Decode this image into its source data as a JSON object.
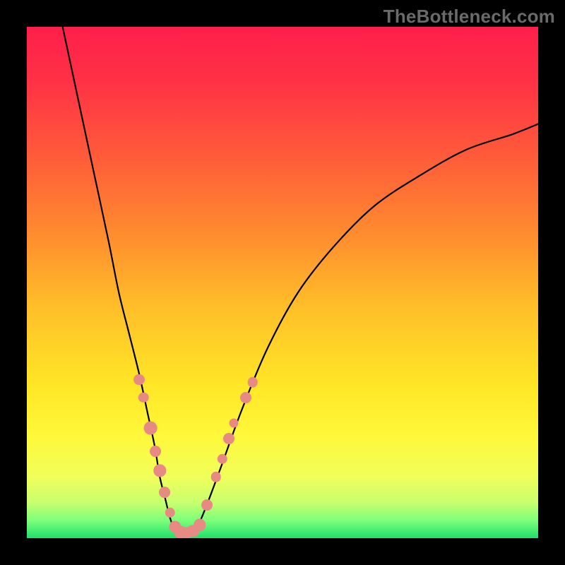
{
  "watermark": "TheBottleneck.com",
  "colors": {
    "bg": "#000000",
    "curve": "#000000",
    "point": "#e88a84",
    "gradient_stops": [
      {
        "offset": 0.0,
        "color": "#ff1f4a"
      },
      {
        "offset": 0.1,
        "color": "#ff3046"
      },
      {
        "offset": 0.25,
        "color": "#ff5a3a"
      },
      {
        "offset": 0.4,
        "color": "#ff8a2f"
      },
      {
        "offset": 0.55,
        "color": "#ffbf28"
      },
      {
        "offset": 0.7,
        "color": "#ffe626"
      },
      {
        "offset": 0.8,
        "color": "#fff83a"
      },
      {
        "offset": 0.88,
        "color": "#f0ff5a"
      },
      {
        "offset": 0.93,
        "color": "#c8ff6e"
      },
      {
        "offset": 0.965,
        "color": "#7dff7a"
      },
      {
        "offset": 1.0,
        "color": "#1fe06a"
      }
    ]
  },
  "chart_data": {
    "type": "line",
    "title": "",
    "xlabel": "",
    "ylabel": "",
    "xlim": [
      0,
      100
    ],
    "ylim": [
      0,
      100
    ],
    "series": [
      {
        "name": "left-arm",
        "x": [
          7,
          10,
          13,
          16,
          18,
          20,
          22,
          23.5,
          25,
          26,
          27,
          28,
          29
        ],
        "values": [
          100,
          86,
          72,
          58,
          48,
          40,
          32,
          25,
          18,
          12,
          8,
          4,
          1.5
        ]
      },
      {
        "name": "bottom",
        "x": [
          29,
          30,
          31,
          32,
          33
        ],
        "values": [
          1.5,
          1,
          1,
          1,
          1.5
        ]
      },
      {
        "name": "right-arm",
        "x": [
          33,
          35,
          38,
          42,
          47,
          53,
          60,
          68,
          77,
          86,
          95,
          100
        ],
        "values": [
          1.5,
          6,
          14,
          25,
          37,
          48,
          57,
          65,
          71,
          76,
          79,
          81
        ]
      }
    ],
    "scatter": {
      "name": "highlight-points",
      "points": [
        {
          "x": 22.0,
          "y": 31.0,
          "r": 1.1
        },
        {
          "x": 22.8,
          "y": 27.5,
          "r": 1.0
        },
        {
          "x": 24.2,
          "y": 21.5,
          "r": 1.3
        },
        {
          "x": 25.2,
          "y": 17.0,
          "r": 1.1
        },
        {
          "x": 26.0,
          "y": 13.2,
          "r": 1.2
        },
        {
          "x": 27.0,
          "y": 9.0,
          "r": 1.1
        },
        {
          "x": 28.0,
          "y": 5.0,
          "r": 1.0
        },
        {
          "x": 29.0,
          "y": 2.2,
          "r": 1.2
        },
        {
          "x": 30.0,
          "y": 1.2,
          "r": 1.2
        },
        {
          "x": 31.2,
          "y": 1.0,
          "r": 1.2
        },
        {
          "x": 32.5,
          "y": 1.4,
          "r": 1.2
        },
        {
          "x": 33.8,
          "y": 2.6,
          "r": 1.2
        },
        {
          "x": 35.2,
          "y": 6.5,
          "r": 1.1
        },
        {
          "x": 37.0,
          "y": 12.0,
          "r": 1.0
        },
        {
          "x": 38.2,
          "y": 15.5,
          "r": 1.0
        },
        {
          "x": 39.5,
          "y": 19.5,
          "r": 1.1
        },
        {
          "x": 40.5,
          "y": 22.5,
          "r": 0.9
        },
        {
          "x": 42.8,
          "y": 27.5,
          "r": 1.1
        },
        {
          "x": 44.2,
          "y": 30.5,
          "r": 1.0
        }
      ]
    }
  }
}
